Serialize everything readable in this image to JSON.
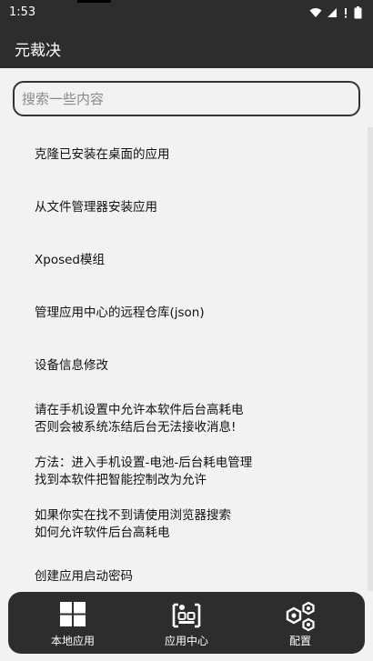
{
  "status_bar": {
    "time": "1:53",
    "icons": [
      "wifi-icon",
      "signal-icon",
      "no-data-icon",
      "battery-icon"
    ]
  },
  "app_bar": {
    "title": "元裁决"
  },
  "search": {
    "placeholder": "搜索一些内容",
    "value": ""
  },
  "menu": {
    "items": [
      {
        "lines": [
          "克隆已安装在桌面的应用"
        ]
      },
      {
        "lines": [
          "从文件管理器安装应用"
        ]
      },
      {
        "lines": [
          "Xposed模组"
        ]
      },
      {
        "lines": [
          "管理应用中心的远程仓库(json)"
        ]
      },
      {
        "lines": [
          "设备信息修改"
        ]
      },
      {
        "lines": [
          "请在手机设置中允许本软件后台高耗电",
          "否则会被系统冻结后台无法接收消息!"
        ]
      },
      {
        "lines": [
          "方法：进入手机设置-电池-后台耗电管理",
          "找到本软件把智能控制改为允许"
        ]
      },
      {
        "lines": [
          "如果你实在找不到请使用浏览器搜索",
          "如何允许软件后台高耗电"
        ]
      },
      {
        "lines": [
          "创建应用启动密码"
        ]
      }
    ]
  },
  "bottom_nav": {
    "tabs": [
      {
        "label": "本地应用",
        "icon": "grid-icon"
      },
      {
        "label": "应用中心",
        "icon": "app-center-icon"
      },
      {
        "label": "配置",
        "icon": "settings-hexagon-icon"
      }
    ]
  },
  "colors": {
    "bar_bg": "#2d2d2d",
    "page_bg": "#f2f2f2",
    "text": "#111111",
    "accent_white": "#ffffff"
  }
}
